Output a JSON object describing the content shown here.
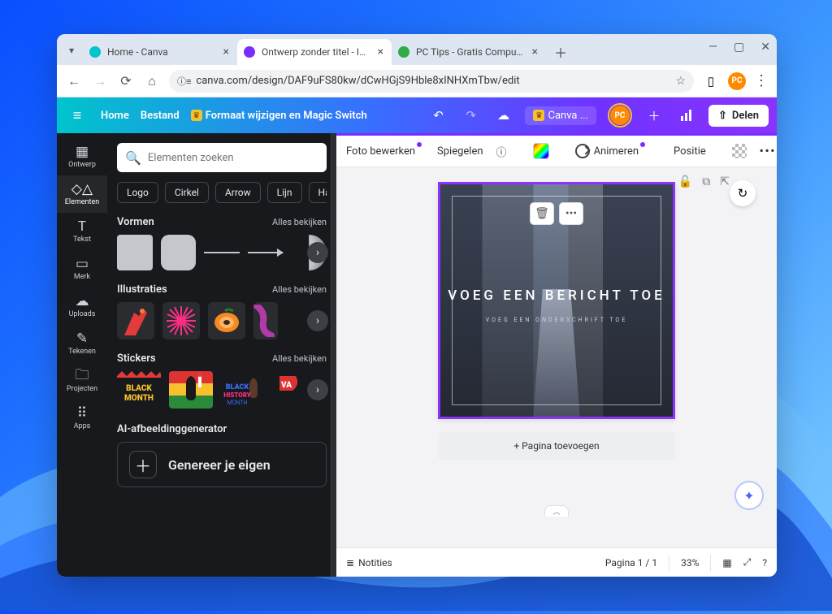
{
  "browser": {
    "tabs": [
      {
        "label": "Home - Canva",
        "favicon": "#00c4cc",
        "active": false
      },
      {
        "label": "Ontwerp zonder titel - Instagra",
        "favicon": "#7a2bff",
        "active": true
      },
      {
        "label": "PC Tips - Gratis Computer Tips.",
        "favicon": "#2eac4b",
        "active": false
      }
    ],
    "url": "canva.com/design/DAF9uFS80kw/dCwHGjS9Hble8xINHXmTbw/edit",
    "profile_initials": "PC"
  },
  "topbar": {
    "home": "Home",
    "file": "Bestand",
    "resize": "Formaat wijzigen en Magic Switch",
    "canva_badge": "Canva ...",
    "share": "Delen"
  },
  "rail": {
    "items": [
      {
        "label": "Ontwerp",
        "key": "design"
      },
      {
        "label": "Elementen",
        "key": "elements"
      },
      {
        "label": "Tekst",
        "key": "text"
      },
      {
        "label": "Merk",
        "key": "brand"
      },
      {
        "label": "Uploads",
        "key": "uploads"
      },
      {
        "label": "Tekenen",
        "key": "draw"
      },
      {
        "label": "Projecten",
        "key": "projects"
      },
      {
        "label": "Apps",
        "key": "apps"
      }
    ],
    "active": "elements"
  },
  "panel": {
    "search_placeholder": "Elementen zoeken",
    "chips": [
      "Logo",
      "Cirkel",
      "Arrow",
      "Lijn",
      "Ha"
    ],
    "shapes_title": "Vormen",
    "illustrations_title": "Illustraties",
    "stickers_title": "Stickers",
    "ai_title": "AI-afbeeldinggenerator",
    "view_all": "Alles bekijken",
    "generate_own": "Genereer je eigen"
  },
  "ctxbar": {
    "edit_photo": "Foto bewerken",
    "mirror": "Spiegelen",
    "animate": "Animeren",
    "position": "Positie"
  },
  "stage": {
    "title": "VOEG EEN BERICHT TOE",
    "subtitle": "VOEG EEN ONDERSCHRIFT TOE",
    "add_page": "+ Pagina toevoegen"
  },
  "bottombar": {
    "notes": "Notities",
    "page_counter": "Pagina 1 / 1",
    "zoom": "33%"
  }
}
